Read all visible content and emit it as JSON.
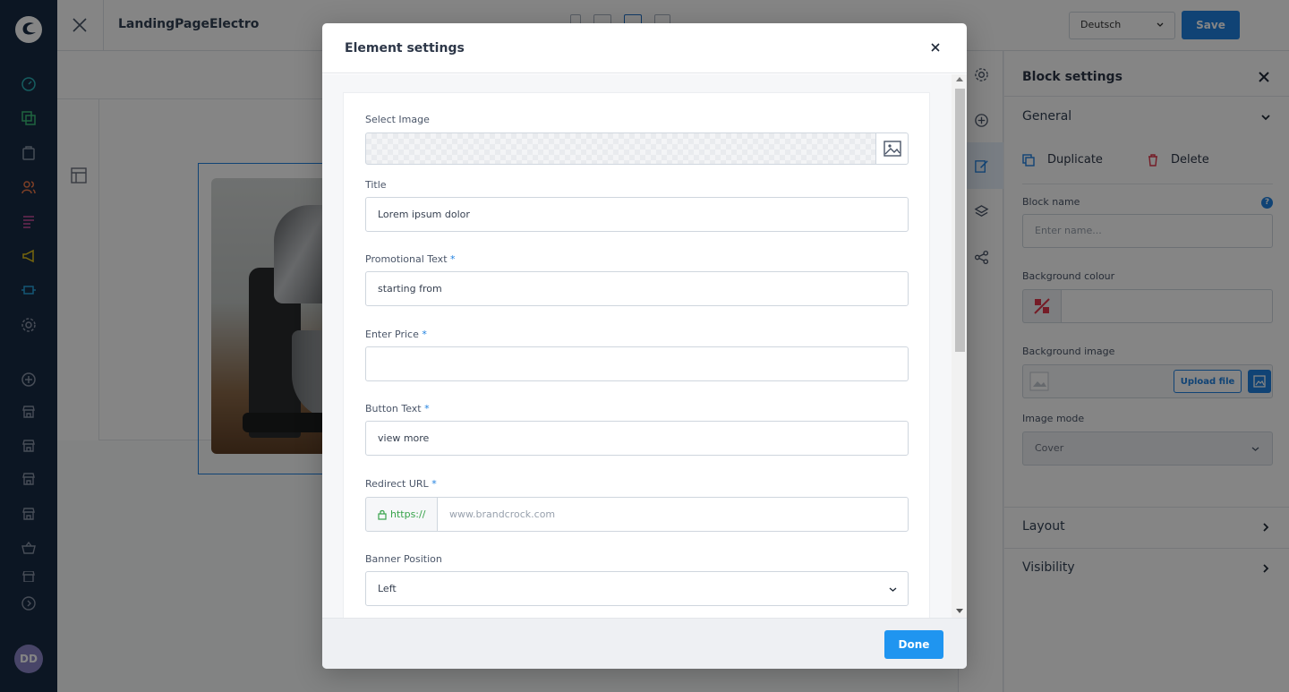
{
  "header": {
    "page_name": "LandingPageElectro",
    "language": "Deutsch",
    "save_label": "Save"
  },
  "user": {
    "initials": "DD"
  },
  "block_settings": {
    "title": "Block settings",
    "general_label": "General",
    "duplicate_label": "Duplicate",
    "delete_label": "Delete",
    "block_name_label": "Block name",
    "block_name_placeholder": "Enter name...",
    "help_mark": "?",
    "bg_colour_label": "Background colour",
    "bg_image_label": "Background image",
    "upload_label": "Upload file",
    "image_mode_label": "Image mode",
    "image_mode_value": "Cover",
    "layout_label": "Layout",
    "visibility_label": "Visibility"
  },
  "modal": {
    "title": "Element settings",
    "select_image_label": "Select Image",
    "title_label": "Title",
    "title_value": "Lorem ipsum dolor",
    "promo_label": "Promotional Text",
    "promo_value": "starting from",
    "price_label": "Enter Price",
    "price_value": "",
    "button_text_label": "Button Text",
    "button_text_value": "view more",
    "redirect_label": "Redirect URL",
    "redirect_prefix": "https://",
    "redirect_placeholder": "www.brandcrock.com",
    "banner_pos_label": "Banner Position",
    "banner_pos_value": "Left",
    "required_mark": "*",
    "done_label": "Done"
  },
  "colors": {
    "accent": "#1f80e0",
    "sidebar_bg": "#172b44",
    "secure_green": "#37a34a",
    "delete_red": "#e0364b"
  },
  "icons": {
    "sidebar": [
      "dashboard-icon",
      "catalog-icon",
      "orders-icon",
      "customers-icon",
      "content-icon",
      "marketing-icon",
      "extensions-icon",
      "settings-icon",
      "add-icon",
      "sales-channel-icon",
      "sales-channel-icon",
      "sales-channel-icon",
      "sales-channel-icon",
      "basket-icon",
      "sales-channel-icon",
      "expand-icon"
    ],
    "right_toolbar": [
      "gear-icon",
      "plus-circle-icon",
      "edit-icon",
      "layers-icon",
      "share-icon"
    ]
  }
}
